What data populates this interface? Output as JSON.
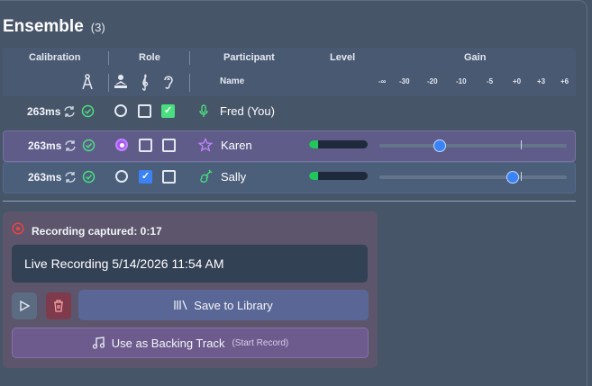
{
  "header": {
    "title": "Ensemble",
    "count": "(3)"
  },
  "table": {
    "columns": {
      "calibration": "Calibration",
      "role": "Role",
      "participant": "Participant",
      "level": "Level",
      "gain": "Gain"
    },
    "sub": {
      "name": "Name",
      "gain_ticks": [
        "-∞",
        "-30",
        "-20",
        "-10",
        "-5",
        "+0",
        "+3",
        "+6"
      ]
    },
    "role_icons": [
      "compass-icon",
      "conductor-icon",
      "treble-clef-icon",
      "ear-icon"
    ],
    "rows": [
      {
        "latency": "263ms",
        "name": "Fred (You)",
        "icon": "microphone-icon",
        "role": {
          "conductor": false,
          "soloist": false,
          "listener": true
        },
        "level": null,
        "gain": null
      },
      {
        "latency": "263ms",
        "name": "Karen",
        "icon": "star-icon",
        "role": {
          "conductor": true,
          "soloist": false,
          "listener": false
        },
        "level": 0.15,
        "gain": 0.32
      },
      {
        "latency": "263ms",
        "name": "Sally",
        "icon": "guitar-icon",
        "role": {
          "conductor": false,
          "soloist": true,
          "listener": false
        },
        "level": 0.15,
        "gain": 0.71
      }
    ]
  },
  "recording": {
    "status": "Recording captured: 0:17",
    "title_value": "Live Recording 5/14/2026 11:54 AM",
    "save_label": "Save to Library",
    "backing_label": "Use as Backing Track",
    "backing_hint": "(Start Record)"
  },
  "colors": {
    "accent_purple": "#a855f7",
    "accent_green": "#4ade80",
    "accent_blue": "#3b82f6",
    "danger": "#ef4444"
  }
}
